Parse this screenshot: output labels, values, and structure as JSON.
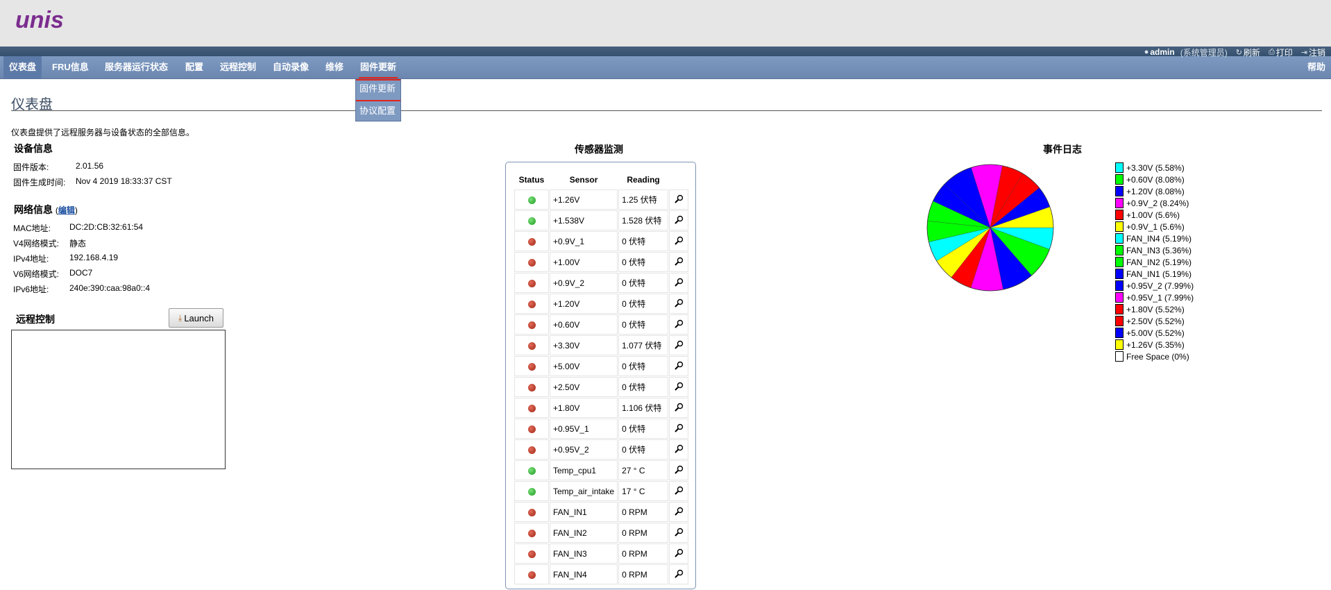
{
  "brand": {
    "logo": "unis"
  },
  "userbar": {
    "user": "admin",
    "role": "(系统管理员)",
    "refresh": "刷新",
    "print": "打印",
    "logout": "注销"
  },
  "nav": {
    "items": [
      "仪表盘",
      "FRU信息",
      "服务器运行状态",
      "配置",
      "远程控制",
      "自动录像",
      "维修",
      "固件更新"
    ],
    "active": "仪表盘",
    "selected": "固件更新",
    "help": "帮助",
    "dropdown": [
      "固件更新",
      "协议配置"
    ]
  },
  "page": {
    "title": "仪表盘",
    "description": "仪表盘提供了远程服务器与设备状态的全部信息。"
  },
  "device": {
    "title": "设备信息",
    "fw_version_label": "固件版本:",
    "fw_version": "2.01.56",
    "fw_date_label": "固件生成时间:",
    "fw_date": "Nov 4 2019 18:33:37 CST"
  },
  "network": {
    "title": "网络信息",
    "edit": "编辑",
    "mac_label": "MAC地址:",
    "mac": "DC:2D:CB:32:61:54",
    "v4mode_label": "V4网络模式:",
    "v4mode": "静态",
    "ipv4_label": "IPv4地址:",
    "ipv4": "192.168.4.19",
    "v6mode_label": "V6网络模式:",
    "v6mode": "DOC7",
    "ipv6_label": "IPv6地址:",
    "ipv6": "240e:390:caa:98a0::4"
  },
  "remote": {
    "title": "远程控制",
    "launch": "Launch"
  },
  "sensors": {
    "title": "传感器监测",
    "headers": {
      "status": "Status",
      "sensor": "Sensor",
      "reading": "Reading"
    },
    "rows": [
      {
        "status": "ok",
        "name": "+1.26V",
        "reading": "1.25 伏特"
      },
      {
        "status": "ok",
        "name": "+1.538V",
        "reading": "1.528 伏特"
      },
      {
        "status": "bad",
        "name": "+0.9V_1",
        "reading": "0 伏特"
      },
      {
        "status": "bad",
        "name": "+1.00V",
        "reading": "0 伏特"
      },
      {
        "status": "bad",
        "name": "+0.9V_2",
        "reading": "0 伏特"
      },
      {
        "status": "bad",
        "name": "+1.20V",
        "reading": "0 伏特"
      },
      {
        "status": "bad",
        "name": "+0.60V",
        "reading": "0 伏特"
      },
      {
        "status": "bad",
        "name": "+3.30V",
        "reading": "1.077 伏特"
      },
      {
        "status": "bad",
        "name": "+5.00V",
        "reading": "0 伏特"
      },
      {
        "status": "bad",
        "name": "+2.50V",
        "reading": "0 伏特"
      },
      {
        "status": "bad",
        "name": "+1.80V",
        "reading": "1.106 伏特"
      },
      {
        "status": "bad",
        "name": "+0.95V_1",
        "reading": "0 伏特"
      },
      {
        "status": "bad",
        "name": "+0.95V_2",
        "reading": "0 伏特"
      },
      {
        "status": "ok",
        "name": "Temp_cpu1",
        "reading": "27 ° C"
      },
      {
        "status": "ok",
        "name": "Temp_air_intake",
        "reading": "17 ° C"
      },
      {
        "status": "bad",
        "name": "FAN_IN1",
        "reading": "0 RPM"
      },
      {
        "status": "bad",
        "name": "FAN_IN2",
        "reading": "0 RPM"
      },
      {
        "status": "bad",
        "name": "FAN_IN3",
        "reading": "0 RPM"
      },
      {
        "status": "bad",
        "name": "FAN_IN4",
        "reading": "0 RPM"
      }
    ]
  },
  "event_log": {
    "title": "事件日志"
  },
  "chart_data": {
    "type": "pie",
    "title": "事件日志",
    "slices": [
      {
        "label": "+3.30V (5.58%)",
        "name": "+3.30V",
        "value": 5.58,
        "color": "#00ffff"
      },
      {
        "label": "+0.60V (8.08%)",
        "name": "+0.60V",
        "value": 8.08,
        "color": "#00ff00"
      },
      {
        "label": "+1.20V (8.08%)",
        "name": "+1.20V",
        "value": 8.08,
        "color": "#0000ff"
      },
      {
        "label": "+0.9V_2 (8.24%)",
        "name": "+0.9V_2",
        "value": 8.24,
        "color": "#ff00ff"
      },
      {
        "label": "+1.00V (5.6%)",
        "name": "+1.00V",
        "value": 5.6,
        "color": "#ff0000"
      },
      {
        "label": "+0.9V_1 (5.6%)",
        "name": "+0.9V_1",
        "value": 5.6,
        "color": "#ffff00"
      },
      {
        "label": "FAN_IN4 (5.19%)",
        "name": "FAN_IN4",
        "value": 5.19,
        "color": "#00ffff"
      },
      {
        "label": "FAN_IN3 (5.36%)",
        "name": "FAN_IN3",
        "value": 5.36,
        "color": "#00ff00"
      },
      {
        "label": "FAN_IN2 (5.19%)",
        "name": "FAN_IN2",
        "value": 5.19,
        "color": "#00ff00"
      },
      {
        "label": "FAN_IN1 (5.19%)",
        "name": "FAN_IN1",
        "value": 5.19,
        "color": "#0000ff"
      },
      {
        "label": "+0.95V_2 (7.99%)",
        "name": "+0.95V_2",
        "value": 7.99,
        "color": "#0000ff"
      },
      {
        "label": "+0.95V_1 (7.99%)",
        "name": "+0.95V_1",
        "value": 7.99,
        "color": "#ff00ff"
      },
      {
        "label": "+1.80V (5.52%)",
        "name": "+1.80V",
        "value": 5.52,
        "color": "#ff0000"
      },
      {
        "label": "+2.50V (5.52%)",
        "name": "+2.50V",
        "value": 5.52,
        "color": "#ff0000"
      },
      {
        "label": "+5.00V (5.52%)",
        "name": "+5.00V",
        "value": 5.52,
        "color": "#0000ff"
      },
      {
        "label": "+1.26V (5.35%)",
        "name": "+1.26V",
        "value": 5.35,
        "color": "#ffff00"
      },
      {
        "label": "Free Space (0%)",
        "name": "Free Space",
        "value": 0,
        "color": "#ffffff"
      }
    ],
    "legend_position": "right"
  }
}
